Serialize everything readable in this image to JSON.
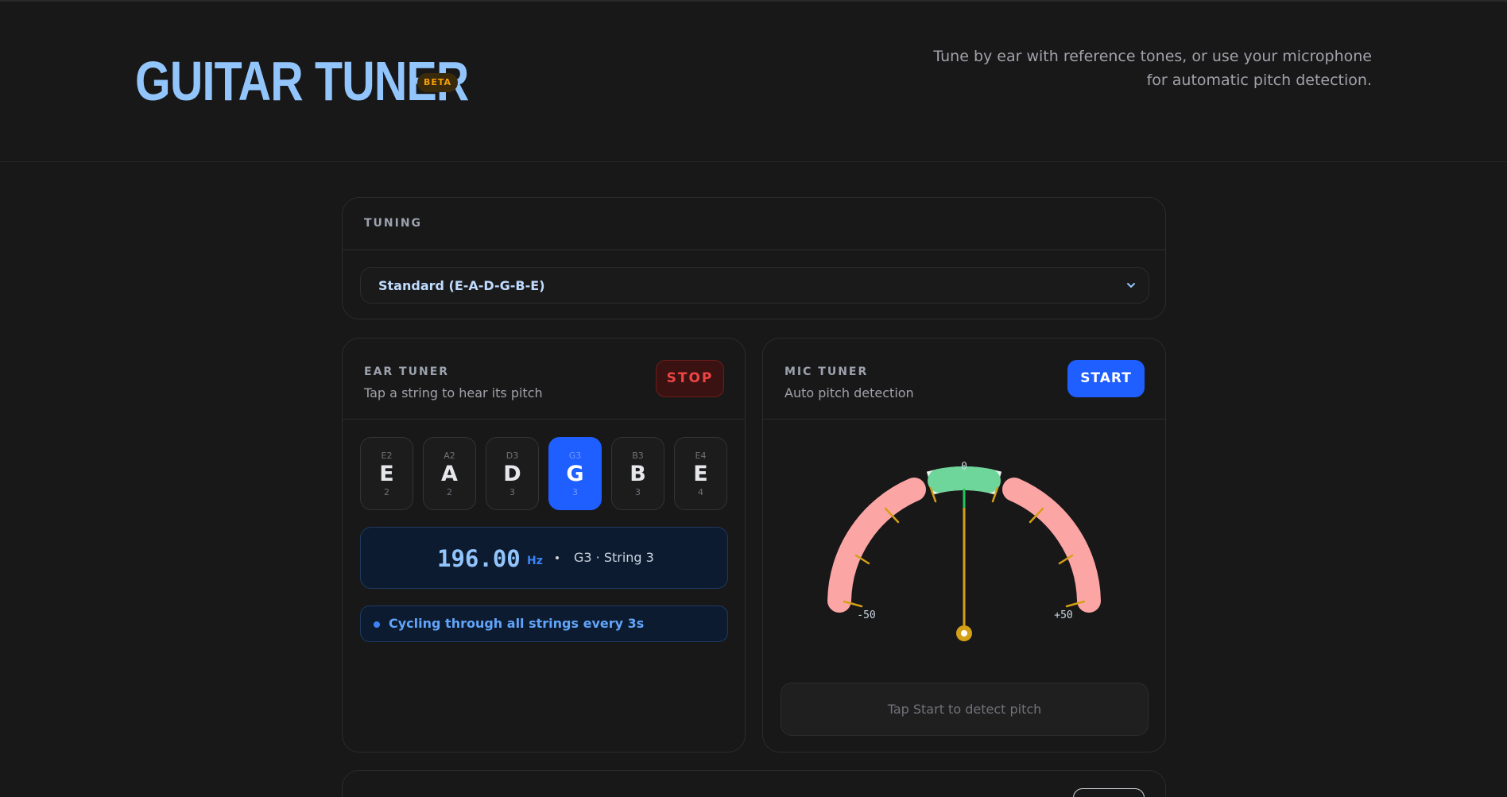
{
  "header": {
    "title": "GUITAR TUNER",
    "badge": "BETA",
    "tagline": "Tune by ear with reference tones, or use your microphone for automatic pitch detection."
  },
  "tuning": {
    "label": "TUNING",
    "selected": "Standard (E-A-D-G-B-E)"
  },
  "ear_tuner": {
    "label": "EAR TUNER",
    "subtitle": "Tap a string to hear its pitch",
    "stop_label": "STOP",
    "strings": [
      {
        "note_full": "E2",
        "note": "E",
        "octave": "2"
      },
      {
        "note_full": "A2",
        "note": "A",
        "octave": "2"
      },
      {
        "note_full": "D3",
        "note": "D",
        "octave": "3"
      },
      {
        "note_full": "G3",
        "note": "G",
        "octave": "3"
      },
      {
        "note_full": "B3",
        "note": "B",
        "octave": "3"
      },
      {
        "note_full": "E4",
        "note": "E",
        "octave": "4"
      }
    ],
    "active_string_index": 3,
    "frequency": "196.00",
    "unit": "Hz",
    "string_info": "G3 · String 3",
    "cycle_message": "Cycling through all strings every 3s"
  },
  "mic_tuner": {
    "label": "MIC TUNER",
    "subtitle": "Auto pitch detection",
    "start_label": "START",
    "gauge": {
      "center_label": "0",
      "min_label": "-50",
      "max_label": "+50",
      "needle_cents": 0
    },
    "status": "Tap Start to detect pitch"
  },
  "colors": {
    "accent": "#1f5eff",
    "title": "#93c5fd",
    "stop": "#ef4444",
    "in_tune": "#6ee7a0",
    "out_of_tune": "#fca5a5",
    "needle": "#d4a017"
  }
}
